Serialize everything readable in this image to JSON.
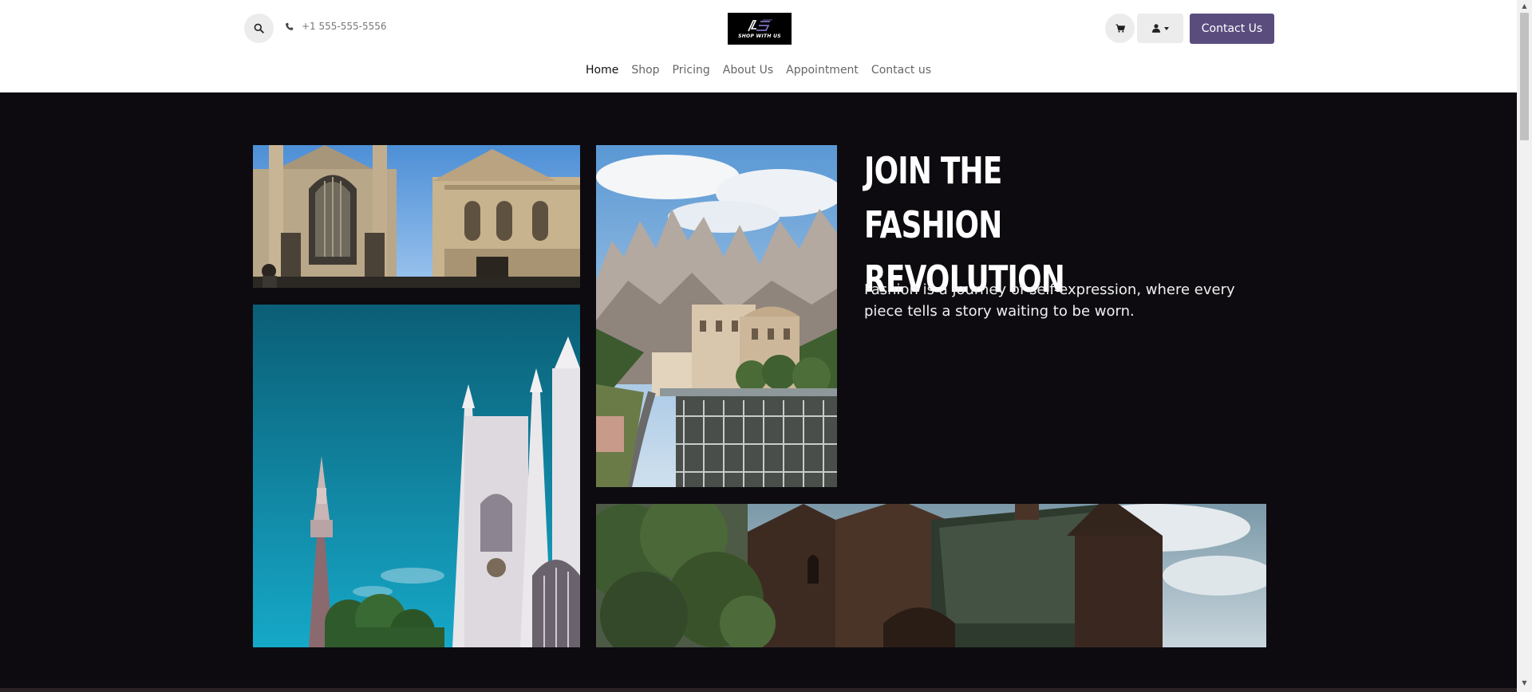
{
  "header": {
    "phone": "+1 555-555-5556",
    "logo_text": "SHOP WITH US",
    "contact_button": "Contact Us",
    "icons": {
      "search": "search-icon",
      "phone": "phone-icon",
      "cart": "cart-icon",
      "user": "user-icon",
      "dropdown": "caret-down-icon"
    }
  },
  "nav": {
    "items": [
      {
        "label": "Home",
        "active": true
      },
      {
        "label": "Shop",
        "active": false
      },
      {
        "label": "Pricing",
        "active": false
      },
      {
        "label": "About Us",
        "active": false
      },
      {
        "label": "Appointment",
        "active": false
      },
      {
        "label": "Contact us",
        "active": false
      }
    ]
  },
  "hero": {
    "title": "JOIN THE FASHION REVOLUTION",
    "text": "Fashion is a journey of self-expression, where every piece tells a story waiting to be worn.",
    "images": [
      "bath-abbey-photo",
      "montserrat-monastery-photo",
      "westminster-abbey-photo",
      "stone-church-photo"
    ]
  },
  "colors": {
    "accent": "#5a4d7e",
    "hero_background": "#0d0b10",
    "header_background": "#ffffff"
  }
}
